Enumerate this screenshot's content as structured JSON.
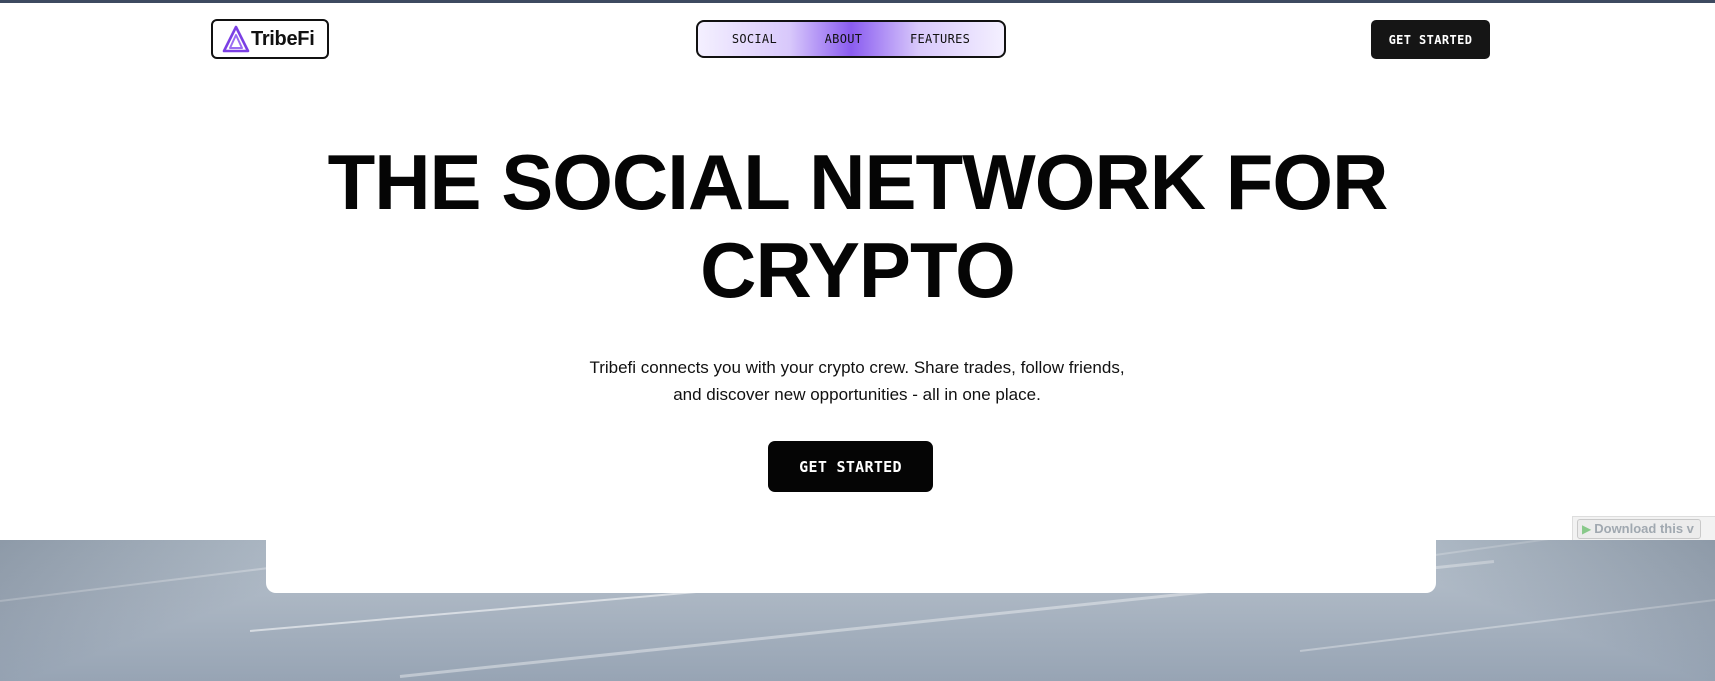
{
  "header": {
    "logo_text": "TribeFi",
    "nav": [
      {
        "label": "SOCIAL"
      },
      {
        "label": "ABOUT"
      },
      {
        "label": "FEATURES"
      }
    ],
    "cta_label": "GET STARTED"
  },
  "hero": {
    "title_line1": "THE SOCIAL NETWORK FOR",
    "title_line2": "CRYPTO",
    "subtitle_line1": "Tribefi connects you with your crypto crew. Share trades, follow friends,",
    "subtitle_line2": "and discover new opportunities - all in one place.",
    "cta_label": "GET STARTED"
  },
  "overlay": {
    "download_label": "Download this v"
  },
  "colors": {
    "nav_accent": "#8a5cf0",
    "logo_accent": "#7b3fe4",
    "button_bg": "#050505"
  },
  "icons": {
    "logo": "tribefi-triangle-logo-icon",
    "download": "play-triangle-icon"
  }
}
